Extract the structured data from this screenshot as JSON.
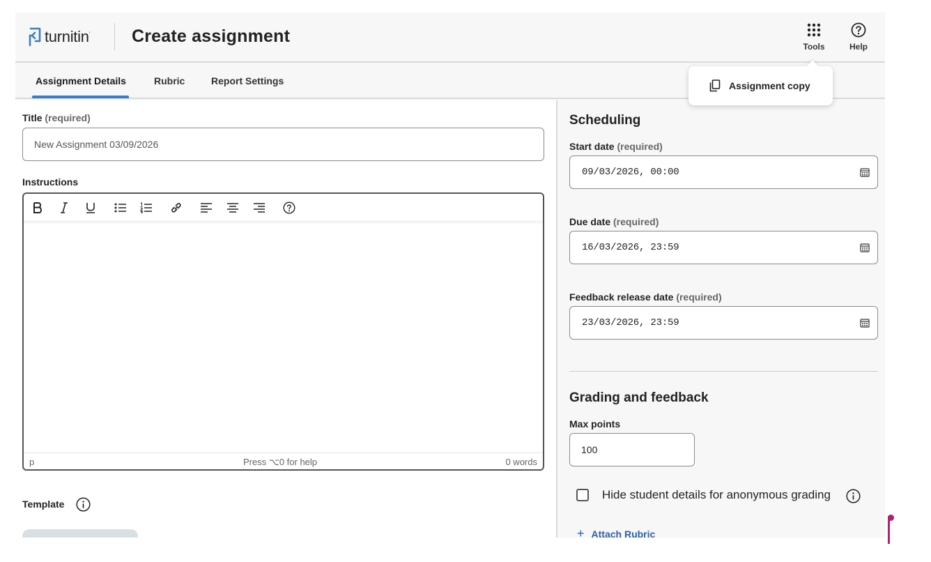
{
  "header": {
    "logo_text": "turnitin",
    "logo_tm": "'",
    "title": "Create assignment",
    "tools_label": "Tools",
    "help_label": "Help"
  },
  "tabs": [
    {
      "label": "Assignment Details",
      "active": true
    },
    {
      "label": "Rubric",
      "active": false
    },
    {
      "label": "Report Settings",
      "active": false
    }
  ],
  "tools_menu": {
    "items": [
      {
        "label": "Assignment copy",
        "icon": "copy-icon"
      }
    ]
  },
  "left": {
    "title_label": "Title",
    "title_req": "(required)",
    "title_value": "New Assignment 03/09/2026",
    "instructions_label": "Instructions",
    "toolbar": [
      "bold-icon",
      "italic-icon",
      "underline-icon",
      "bullet-list-icon",
      "numbered-list-icon",
      "link-icon",
      "align-left-icon",
      "align-center-icon",
      "align-right-icon",
      "help-circle-icon"
    ],
    "status_path": "p",
    "status_help": "Press ⌥0 for help",
    "status_words": "0 words",
    "template_label": "Template"
  },
  "scheduling": {
    "title": "Scheduling",
    "start_label": "Start date",
    "due_label": "Due date",
    "feedback_label": "Feedback release date",
    "req": "(required)",
    "start_value": "09/03/2026, 00:00",
    "due_value": "16/03/2026, 23:59",
    "feedback_value": "23/03/2026, 23:59"
  },
  "grading": {
    "title": "Grading and feedback",
    "max_points_label": "Max points",
    "max_points_value": "100",
    "anon_label": "Hide student details for anonymous grading",
    "attach_label": "Attach Rubric"
  },
  "colors": {
    "accent": "#3b7ccf",
    "link": "#2c5fa8",
    "brand_pink": "#b0216f"
  }
}
